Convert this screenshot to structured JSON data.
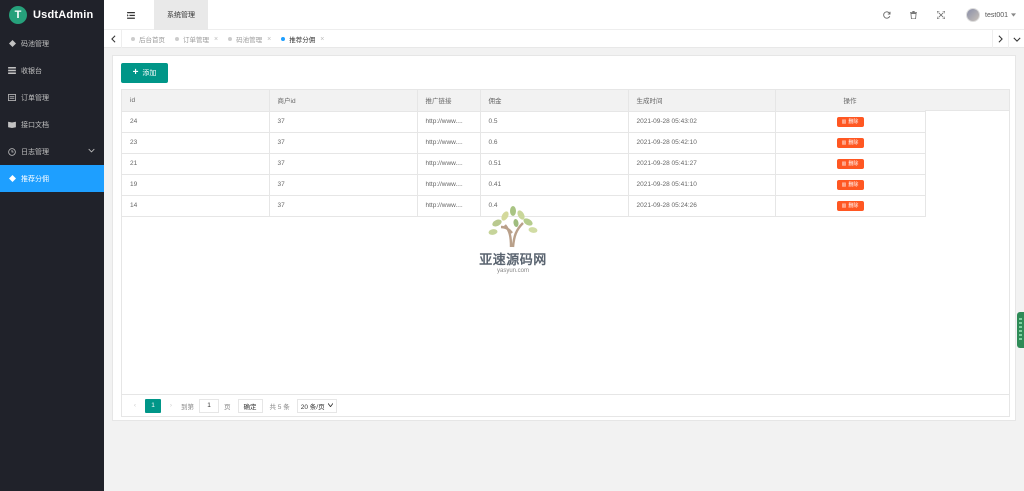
{
  "app": {
    "logo_letter": "T",
    "logo_text": "UsdtAdmin",
    "brand_color": "#26a17b"
  },
  "sidebar": {
    "items": [
      {
        "label": "码池管理",
        "icon": "diamond-icon"
      },
      {
        "label": "收银台",
        "icon": "list-icon"
      },
      {
        "label": "订单管理",
        "icon": "doc-icon"
      },
      {
        "label": "接口文档",
        "icon": "book-icon"
      },
      {
        "label": "日志管理",
        "icon": "clock-icon"
      },
      {
        "label": "推荐分佣",
        "icon": "diamond-icon"
      }
    ],
    "active_index": 5
  },
  "header": {
    "system_tab": "系统管理",
    "username": "test001"
  },
  "tabs": [
    {
      "label": "后台首页"
    },
    {
      "label": "订单管理"
    },
    {
      "label": "码池管理"
    },
    {
      "label": "推荐分佣"
    }
  ],
  "toolbar": {
    "add_label": "添加"
  },
  "table": {
    "columns": [
      "id",
      "商户id",
      "推广链接",
      "佣金",
      "生成时间",
      "操作"
    ],
    "rows": [
      {
        "id": "24",
        "merchant": "37",
        "link": "http://www....",
        "commission": "0.5",
        "time": "2021-09-28 05:43:02"
      },
      {
        "id": "23",
        "merchant": "37",
        "link": "http://www....",
        "commission": "0.6",
        "time": "2021-09-28 05:42:10"
      },
      {
        "id": "21",
        "merchant": "37",
        "link": "http://www....",
        "commission": "0.51",
        "time": "2021-09-28 05:41:27"
      },
      {
        "id": "19",
        "merchant": "37",
        "link": "http://www....",
        "commission": "0.41",
        "time": "2021-09-28 05:41:10"
      },
      {
        "id": "14",
        "merchant": "37",
        "link": "http://www....",
        "commission": "0.4",
        "time": "2021-09-28 05:24:26"
      }
    ],
    "delete_label": "删除"
  },
  "pagination": {
    "current": "1",
    "goto_label": "到第",
    "page_input": "1",
    "page_suffix": "页",
    "confirm_label": "确定",
    "total_label": "共 5 条",
    "page_size": "20 条/页"
  },
  "watermark": {
    "text": "亚速源码网",
    "sub": "yasyun.com"
  },
  "colors": {
    "active_menu": "#1e9fff",
    "primary": "#009688",
    "danger": "#ff5722",
    "sidebar_bg": "#20222a"
  }
}
